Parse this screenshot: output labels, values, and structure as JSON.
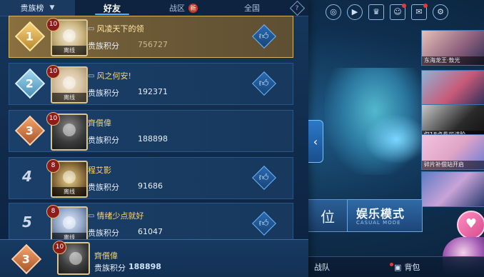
{
  "tabs": {
    "guild_label": "贵族榜",
    "friends_label": "好友",
    "zone_label": "战区",
    "zone_badge": "新",
    "national_label": "全国",
    "help_icon_text": "?"
  },
  "score_label": "贵族积分",
  "offline_label": "离线",
  "rows": [
    {
      "rank": "1",
      "level": "10",
      "name": "风凌天下的领",
      "score": "756727"
    },
    {
      "rank": "2",
      "level": "10",
      "name": "风之何安!",
      "score": "192371"
    },
    {
      "rank": "3",
      "level": "10",
      "name": "齊儨偉",
      "score": "188898"
    },
    {
      "rank": "4",
      "level": "8",
      "name": "程艾影",
      "score": "91686"
    },
    {
      "rank": "5",
      "level": "8",
      "name": "情绪少点就好",
      "score": "61047"
    }
  ],
  "my_row": {
    "rank": "3",
    "level": "10",
    "name": "齊儨偉",
    "score": "188898"
  },
  "lobby": {
    "side_cards": [
      "东海龙王·敖光",
      "",
      "仅18点券可进阶",
      "碎片补偿站开启",
      ""
    ],
    "mode_left_text": "位",
    "mode_ent_title": "娱乐模式",
    "mode_ent_sub": "CASUAL MODE",
    "bottom_team": "战队",
    "bottom_bag": "背包"
  },
  "colors": {
    "accent": "#4fb3ff",
    "gold": "#f2d57e",
    "panel": "#16385c"
  }
}
